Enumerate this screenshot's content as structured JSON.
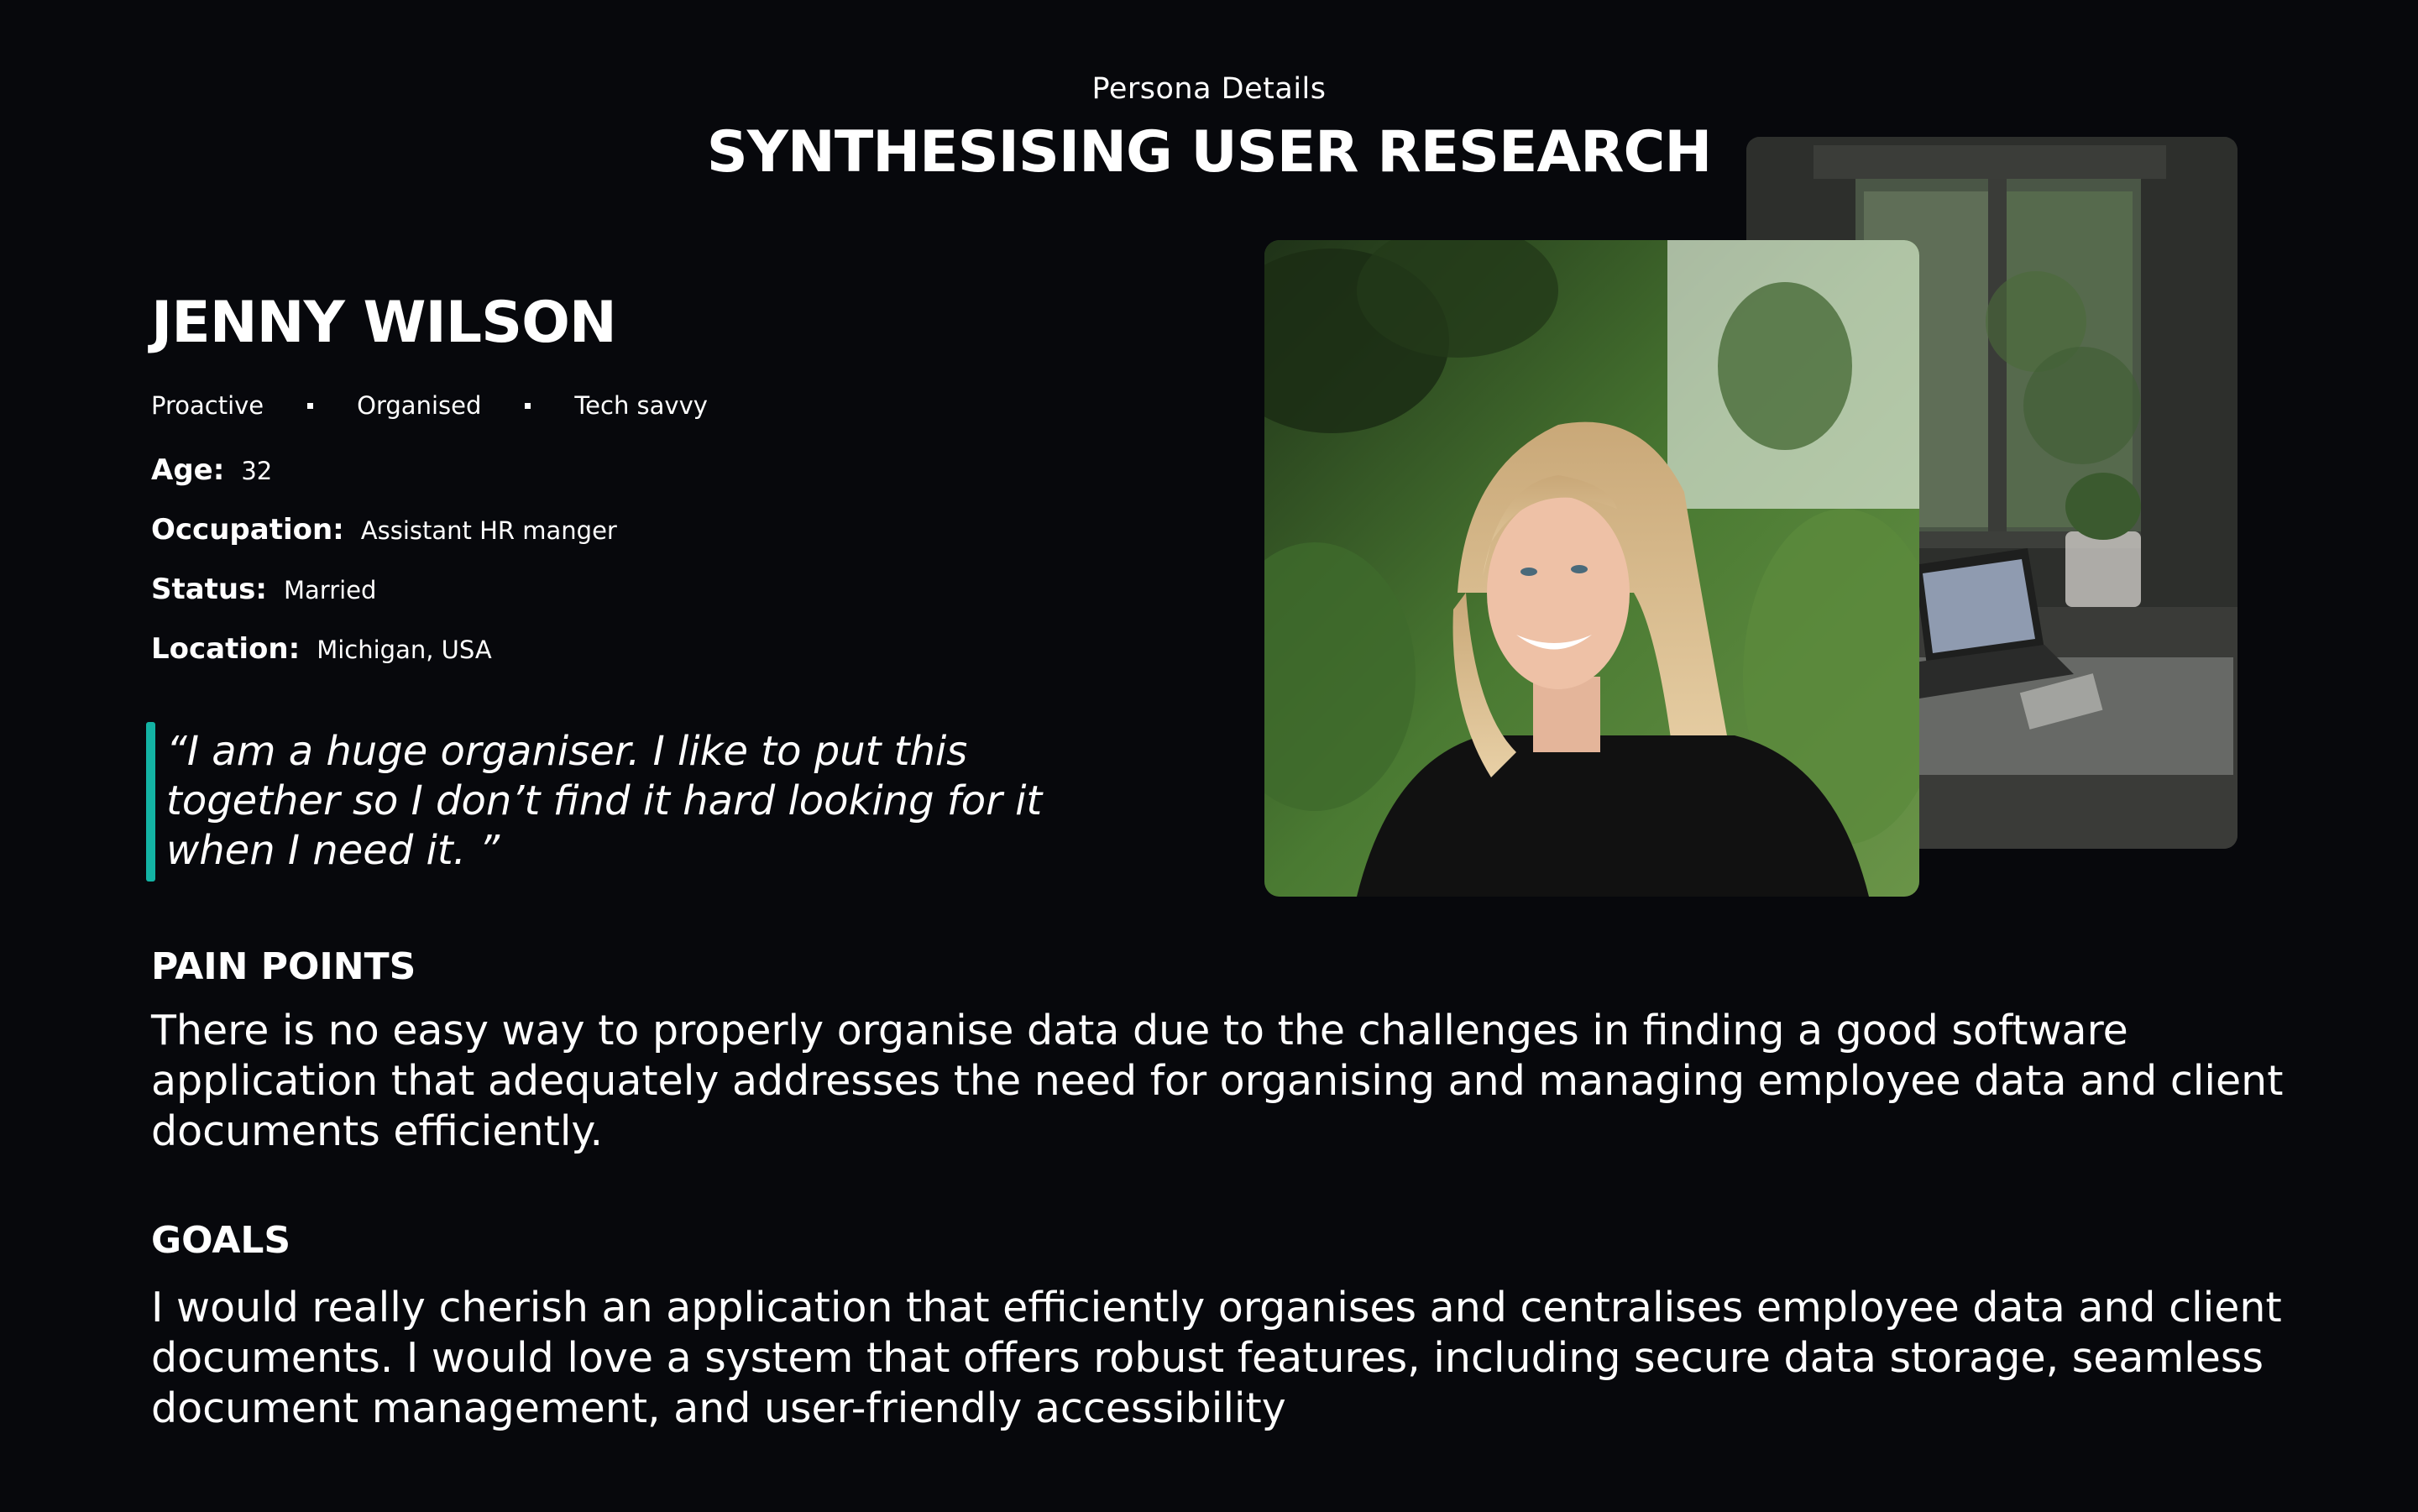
{
  "header": {
    "eyebrow": "Persona Details",
    "title": "SYNTHESISING USER RESEARCH"
  },
  "persona": {
    "name": "JENNY WILSON",
    "traits": [
      "Proactive",
      "Organised",
      "Tech savvy"
    ],
    "details": [
      {
        "label": "Age:",
        "value": "32"
      },
      {
        "label": "Occupation:",
        "value": "Assistant HR manger"
      },
      {
        "label": "Status:",
        "value": "Married"
      },
      {
        "label": "Location:",
        "value": "Michigan, USA"
      }
    ],
    "quote": "“I am a huge organiser. I like to put this together so I don’t find it hard looking for it when I need it. ”"
  },
  "pain_points": {
    "heading": "PAIN POINTS",
    "body": "There is no easy way to properly organise data due to the challenges in finding a good software application that adequately addresses the need for organising and managing employee data and client documents efficiently."
  },
  "goals": {
    "heading": "GOALS",
    "body": "I would really cherish an application that efficiently organises and centralises employee data and client documents. I would love a system that offers robust features, including secure data storage, seamless document management, and user-friendly accessibility"
  },
  "colors": {
    "background": "#07080c",
    "accent": "#13b3a4",
    "text": "#ffffff"
  }
}
